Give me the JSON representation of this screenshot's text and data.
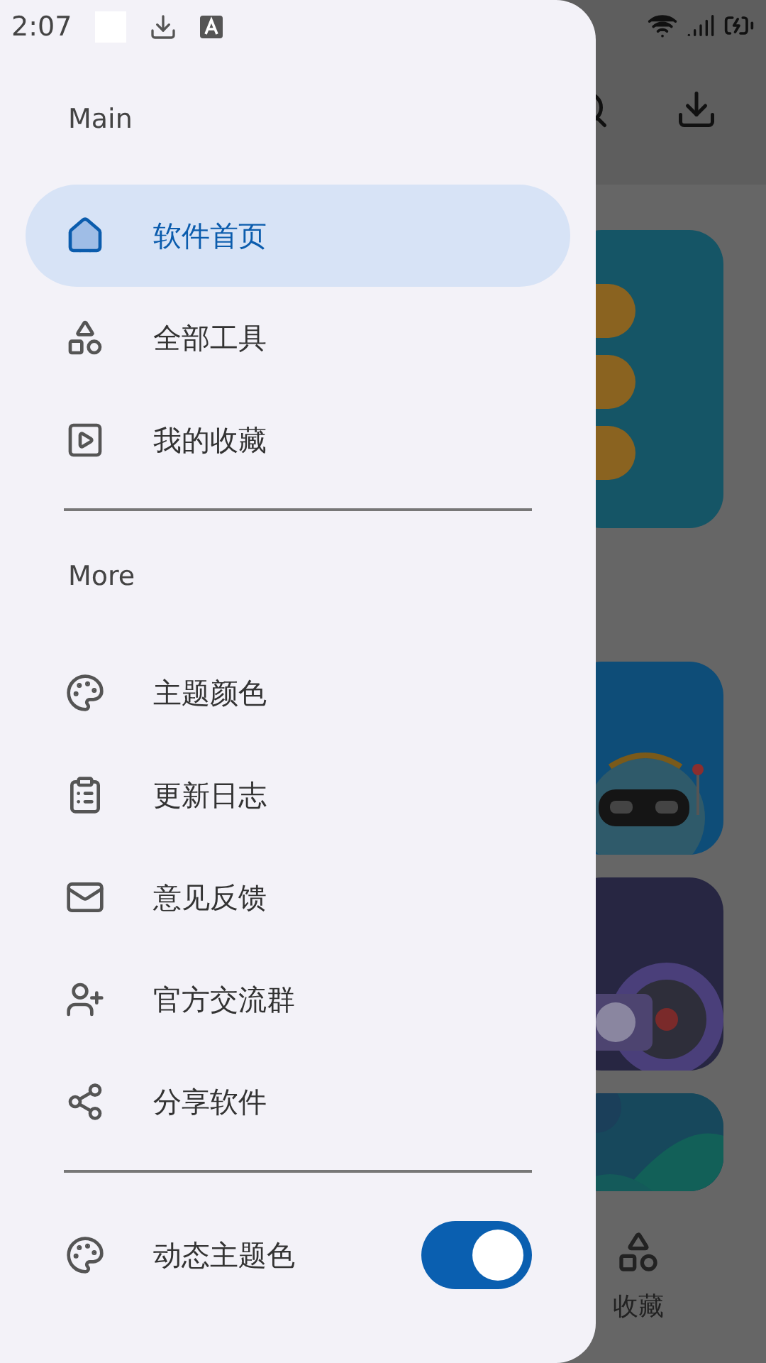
{
  "status_bar": {
    "time": "2:07"
  },
  "drawer": {
    "sections": [
      {
        "title": "Main",
        "items": [
          {
            "label": "软件首页",
            "selected": true
          },
          {
            "label": "全部工具",
            "selected": false
          },
          {
            "label": "我的收藏",
            "selected": false
          }
        ]
      },
      {
        "title": "More",
        "items": [
          {
            "label": "主题颜色",
            "selected": false
          },
          {
            "label": "更新日志",
            "selected": false
          },
          {
            "label": "意见反馈",
            "selected": false
          },
          {
            "label": "官方交流群",
            "selected": false
          },
          {
            "label": "分享软件",
            "selected": false
          }
        ]
      }
    ],
    "toggle": {
      "label": "动态主题色",
      "on": true
    }
  },
  "background": {
    "bottom_nav": [
      {
        "label": "收藏"
      }
    ]
  }
}
